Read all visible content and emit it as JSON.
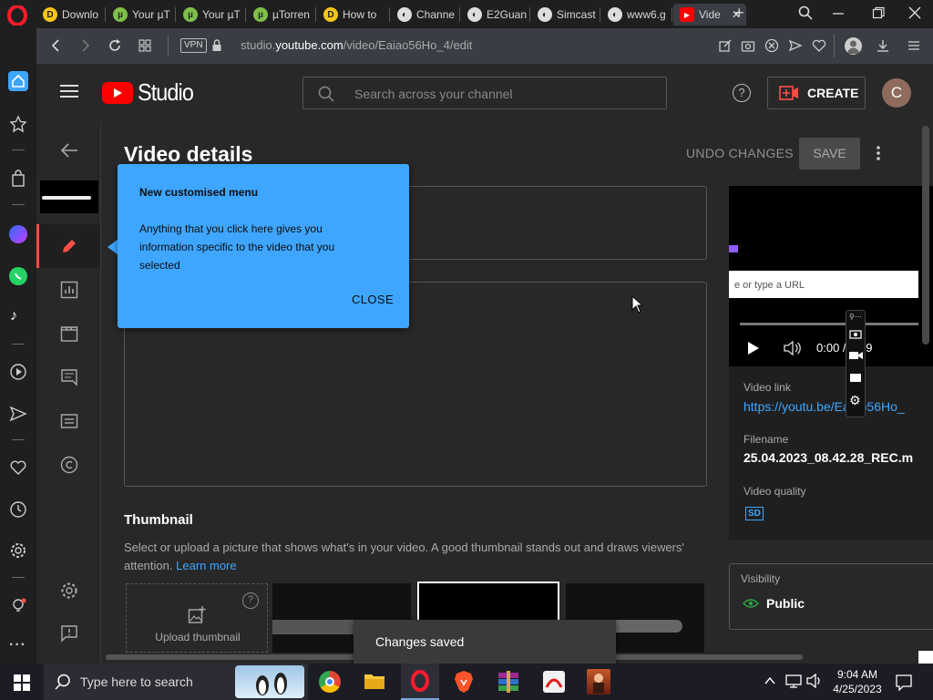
{
  "tabs": [
    {
      "label": "Downlo",
      "fav_color": "#f5c518",
      "fav_glyph": "D"
    },
    {
      "label": "Your µT",
      "fav_color": "#7ec04b",
      "fav_glyph": "µ"
    },
    {
      "label": "Your µT",
      "fav_color": "#7ec04b",
      "fav_glyph": "µ"
    },
    {
      "label": "µTorren",
      "fav_color": "#7ec04b",
      "fav_glyph": "µ"
    },
    {
      "label": "How to",
      "fav_color": "#f5c518",
      "fav_glyph": "D"
    },
    {
      "label": "Channe",
      "fav_color": "#dddddd",
      "fav_glyph": "◐"
    },
    {
      "label": "E2Guan",
      "fav_color": "#dddddd",
      "fav_glyph": "◐"
    },
    {
      "label": "Simcast",
      "fav_color": "#dddddd",
      "fav_glyph": "◐"
    },
    {
      "label": "www6.g",
      "fav_color": "#dddddd",
      "fav_glyph": "◐"
    },
    {
      "label": "Vide",
      "fav_color": "#ff0000",
      "fav_glyph": "▶"
    }
  ],
  "address": {
    "vpn": "VPN",
    "url_prefix": "studio.",
    "url_domain": "youtube.com",
    "url_path": "/video/Eaiao56Ho_4/edit"
  },
  "header": {
    "studio_label": "Studio",
    "search_placeholder": "Search across your channel",
    "help": "?",
    "create_label": "CREATE",
    "avatar_letter": "C"
  },
  "page": {
    "title": "Video details",
    "undo_label": "UNDO CHANGES",
    "save_label": "SAVE",
    "thumbnail_heading": "Thumbnail",
    "thumbnail_desc": "Select or upload a picture that shows what's in your video. A good thumbnail stands out and draws viewers' attention.",
    "learn_more": "Learn more",
    "upload_thumbnail": "Upload thumbnail"
  },
  "tooltip": {
    "title": "New customised menu",
    "body": "Anything that you click here gives you information specific to the video that you selected",
    "close_label": "CLOSE"
  },
  "preview": {
    "url_placeholder": "e or type a URL",
    "time": "0:00 / 0:09",
    "video_link_label": "Video link",
    "video_link": "https://youtu.be/Eaiao56Ho_",
    "filename_label": "Filename",
    "filename": "25.04.2023_08.42.28_REC.m",
    "quality_label": "Video quality",
    "quality_badge": "SD",
    "visibility_label": "Visibility",
    "visibility_value": "Public"
  },
  "toast": {
    "text": "Changes saved"
  },
  "taskbar": {
    "search_placeholder": "Type here to search",
    "time": "9:04 AM",
    "date": "4/25/2023"
  },
  "colors": {
    "accent_blue": "#3ea6ff",
    "youtube_red": "#ff0000",
    "tooltip_bg": "#3ea6ff",
    "public_green": "#2ba640"
  }
}
